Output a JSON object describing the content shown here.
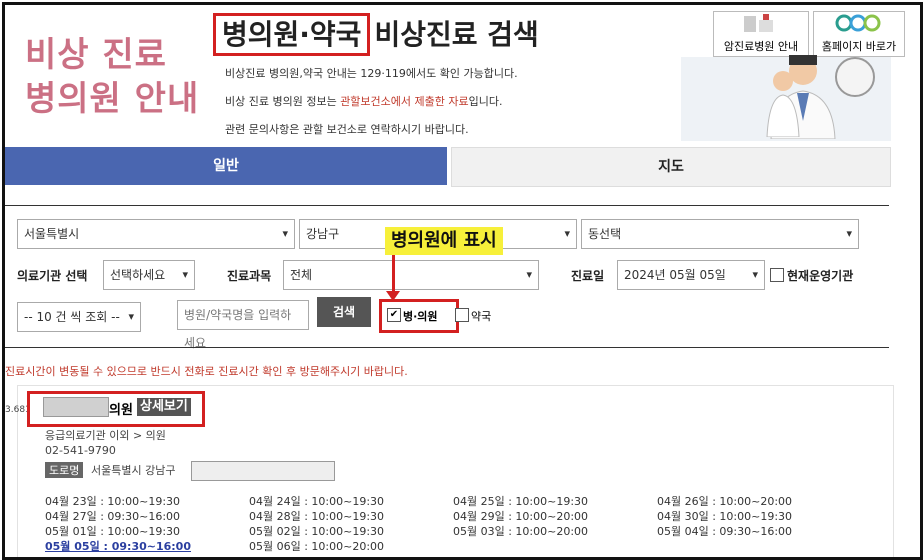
{
  "header": {
    "left_title_line1": "비상 진료",
    "left_title_line2": "병의원 안내",
    "title_highlight": "병의원·약국",
    "title_rest": "비상진료 검색",
    "desc1": "비상진료 병의원,약국 안내는 129·119에서도 확인 가능합니다.",
    "desc2_pre": "비상 진료 병의원 정보는 ",
    "desc2_red": "관할보건소에서 제출한 자료",
    "desc2_post": "입니다.",
    "desc3": "관련 문의사항은 관할 보건소로 연락하시기 바랍니다.",
    "quick1": "암진료병원 안내",
    "quick2": "홈페이지 바로가"
  },
  "tabs": [
    {
      "label": "일반"
    },
    {
      "label": "지도"
    }
  ],
  "filters": {
    "region": "서울특별시",
    "district": "강남구",
    "dong": "동선택",
    "institution_label": "의료기관 선택",
    "institution_value": "선택하세요",
    "subject_label": "진료과목",
    "subject_value": "전체",
    "date_label": "진료일",
    "date_value": "2024년 05월 05일",
    "open_now": "현재운영기관",
    "page_size": "-- 10 건 씩 조회 --",
    "search_placeholder": "병원/약국명을 입력하세요",
    "search_button": "검색",
    "hospital_check": "병·의원",
    "pharmacy_check": "약국"
  },
  "annotation": "병의원에 표시",
  "notice": "진료시간이 변동될 수 있으므로 반드시 전화로 진료시간 확인 후 방문해주시기 바랍니다.",
  "result": {
    "side_text": "3.681",
    "name_suffix": "의원",
    "detail_button": "상세보기",
    "category": "응급의료기관 이외 > 의원",
    "phone": "02-541-9790",
    "road_badge": "도로명",
    "address": "서울특별시 강남구",
    "schedule": [
      [
        "04월 23일 : 10:00~19:30",
        "04월 24일 : 10:00~19:30",
        "04월 25일 : 10:00~19:30",
        "04월 26일 : 10:00~20:00"
      ],
      [
        "04월 27일 : 09:30~16:00",
        "04월 28일 : 10:00~19:30",
        "04월 29일 : 10:00~20:00",
        "04월 30일 : 10:00~19:30"
      ],
      [
        "05월 01일 : 10:00~19:30",
        "05월 02일 : 10:00~19:30",
        "05월 03일 : 10:00~20:00",
        "05월 04일 : 09:30~16:00"
      ],
      [
        "05월 05일 : 09:30~16:00",
        "05월 06일 : 10:00~20:00",
        "",
        ""
      ]
    ]
  }
}
